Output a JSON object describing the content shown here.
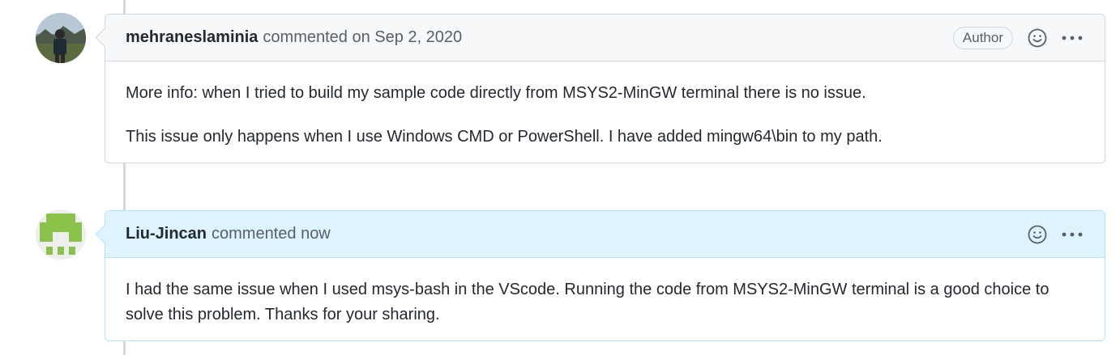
{
  "comments": [
    {
      "author": "mehraneslaminia",
      "action": "commented on Sep 2, 2020",
      "badge": "Author",
      "paragraphs": [
        "More info: when I tried to build my sample code directly from MSYS2-MinGW terminal there is no issue.",
        "This issue only happens when I use Windows CMD or PowerShell. I have added mingw64\\bin to my path."
      ],
      "icons": [
        "smiley-icon",
        "kebab-menu-icon"
      ]
    },
    {
      "author": "Liu-Jincan",
      "action": "commented now",
      "paragraphs": [
        "I had the same issue when I used msys-bash in the VScode. Running the code from MSYS2-MinGW terminal is a good choice to solve this problem. Thanks for your sharing."
      ],
      "icons": [
        "smiley-icon",
        "kebab-menu-icon"
      ]
    }
  ],
  "colors": {
    "border": "#d0d7de",
    "header_bg": "#f6f8fa",
    "current_header_bg": "#ddf4ff",
    "current_border": "#b6e3ff",
    "identicon_green": "#8bc34a"
  }
}
